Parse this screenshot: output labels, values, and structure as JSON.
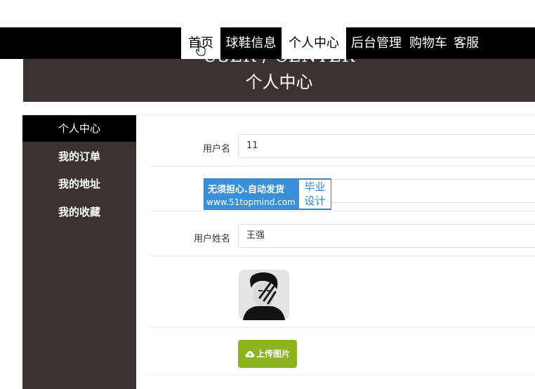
{
  "nav": {
    "items": [
      "首页",
      "球鞋信息",
      "个人中心",
      "后台管理",
      "购物车",
      "客服"
    ]
  },
  "banner": {
    "subtitle": "USER / CENTER",
    "title": "个人中心"
  },
  "sidebar": {
    "items": [
      "个人中心",
      "我的订单",
      "我的地址",
      "我的收藏"
    ],
    "active": "个人中心"
  },
  "form": {
    "username_label": "用户名",
    "username_value": "11",
    "realname_label": "用户姓名",
    "realname_value": "王强",
    "upload_label": "上传图片"
  },
  "watermark": {
    "line1": "无须担心.自动发货",
    "line2": "www.51topmind.com",
    "right_line1": "毕业",
    "right_line2": "设计"
  },
  "colors": {
    "nav_bg": "#000000",
    "sidebar_bg": "#3b3330",
    "upload_btn": "#8cb21d",
    "watermark_bg": "#3b8fd6"
  },
  "icons": {
    "upload": "cloud-upload-icon"
  }
}
